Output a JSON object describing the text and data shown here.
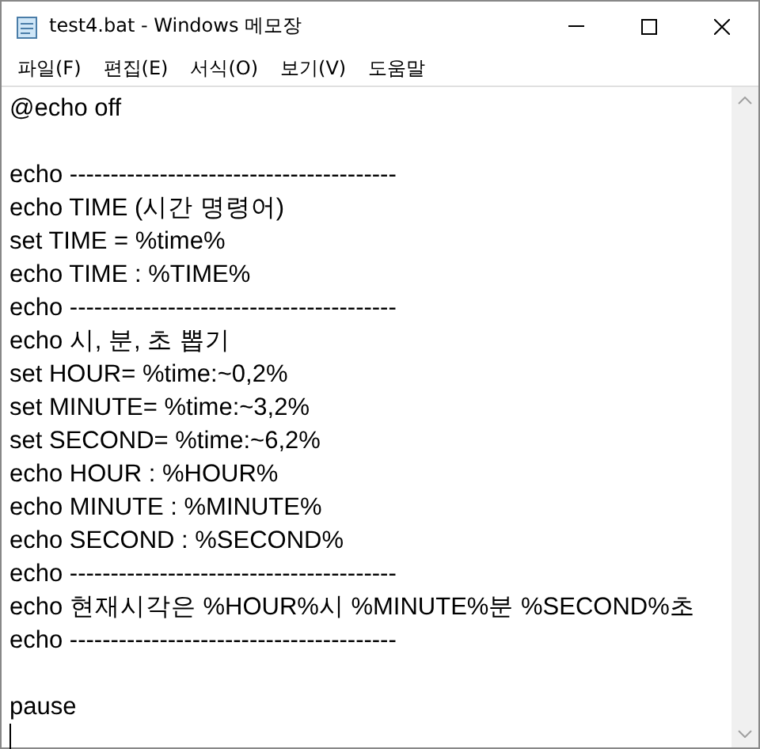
{
  "window": {
    "title": "test4.bat - Windows 메모장"
  },
  "menu": [
    "파일(F)",
    "편집(E)",
    "서식(O)",
    "보기(V)",
    "도움말"
  ],
  "blocks": [
    [
      "@echo off"
    ],
    [
      "echo ----------------------------------------",
      "echo TIME (시간 명령어)",
      "set TIME = %time%",
      "echo TIME : %TIME%",
      "echo ----------------------------------------",
      "echo 시, 분, 초 뽑기",
      "set HOUR= %time:~0,2%",
      "set MINUTE= %time:~3,2%",
      "set SECOND= %time:~6,2%",
      "echo HOUR : %HOUR%",
      "echo MINUTE : %MINUTE%",
      "echo SECOND : %SECOND%",
      "echo ----------------------------------------",
      "echo 현재시각은 %HOUR%시 %MINUTE%분 %SECOND%초",
      "echo ----------------------------------------"
    ],
    [
      "pause"
    ]
  ]
}
